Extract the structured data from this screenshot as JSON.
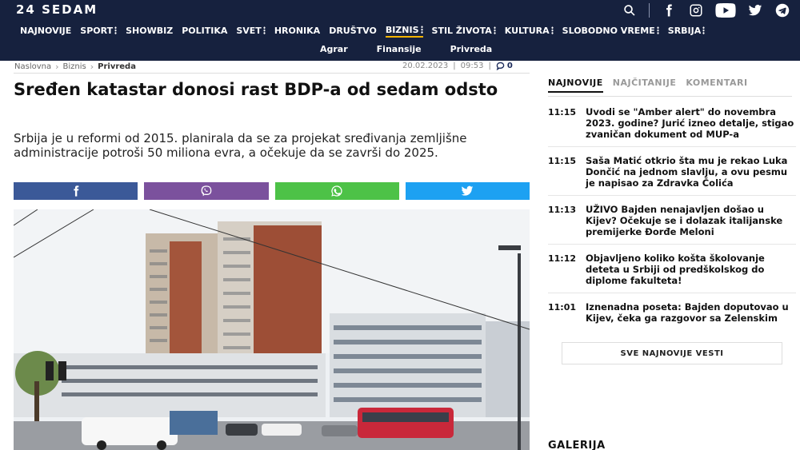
{
  "header": {
    "logo": "24 SEDAM",
    "nav": [
      {
        "label": "NAJNOVIJE",
        "dots": false,
        "active": false
      },
      {
        "label": "SPORT",
        "dots": true,
        "active": false
      },
      {
        "label": "SHOWBIZ",
        "dots": false,
        "active": false
      },
      {
        "label": "POLITIKA",
        "dots": false,
        "active": false
      },
      {
        "label": "SVET",
        "dots": true,
        "active": false
      },
      {
        "label": "HRONIKA",
        "dots": false,
        "active": false
      },
      {
        "label": "DRUŠTVO",
        "dots": false,
        "active": false
      },
      {
        "label": "BIZNIS",
        "dots": true,
        "active": true
      },
      {
        "label": "STIL ŽIVOTA",
        "dots": true,
        "active": false
      },
      {
        "label": "KULTURA",
        "dots": true,
        "active": false
      },
      {
        "label": "SLOBODNO VREME",
        "dots": true,
        "active": false
      },
      {
        "label": "SRBIJA",
        "dots": true,
        "active": false
      }
    ],
    "subnav": [
      "Agrar",
      "Finansije",
      "Privreda"
    ],
    "icons": [
      "search-icon",
      "facebook-icon",
      "instagram-icon",
      "youtube-icon",
      "twitter-icon",
      "telegram-icon"
    ]
  },
  "breadcrumb": [
    "Naslovna",
    "Biznis",
    "Privreda"
  ],
  "meta": {
    "date": "20.02.2023",
    "time": "09:53",
    "comments": "0"
  },
  "article": {
    "title": "Sređen katastar donosi rast BDP-a od sedam odsto",
    "lead": "Srbija je u reformi od 2015. planirala da se za projekat sređivanja zemljišne administracije potroši 50 miliona evra, a očekuje da se završi do 2025.",
    "share": [
      {
        "name": "facebook",
        "color": "#3b5998"
      },
      {
        "name": "viber",
        "color": "#7b519d"
      },
      {
        "name": "whatsapp",
        "color": "#4dc247"
      },
      {
        "name": "twitter",
        "color": "#1da1f2"
      }
    ]
  },
  "sidebar": {
    "tabs": [
      "NAJNOVIJE",
      "NAJČITANIJE",
      "KOMENTARI"
    ],
    "news": [
      {
        "time": "11:15",
        "title": "Uvodi se \"Amber alert\" do novembra 2023. godine? Jurić izneo detalje, stigao zvaničan dokument od MUP-a"
      },
      {
        "time": "11:15",
        "title": "Saša Matić otkrio šta mu je rekao Luka Dončić na jednom slavlju, a ovu pesmu je napisao za Zdravka Čolića"
      },
      {
        "time": "11:13",
        "title": "UŽIVO Bajden nenajavljen došao u Kijev? Očekuje se i dolazak italijanske premijerke Đorđe Meloni"
      },
      {
        "time": "11:12",
        "title": "Objavljeno koliko košta školovanje deteta u Srbiji od predškolskog do diplome fakulteta!"
      },
      {
        "time": "11:01",
        "title": "Iznenadna poseta: Bajden doputovao u Kijev, čeka ga razgovor sa Zelenskim"
      }
    ],
    "all_news": "SVE NAJNOVIJE VESTI",
    "gallery": "GALERIJA"
  }
}
